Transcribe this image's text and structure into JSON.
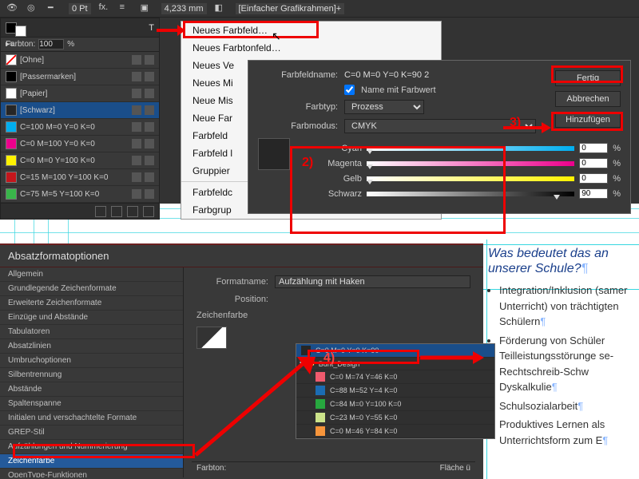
{
  "topbar": {
    "stroke_pt": "0 Pt",
    "dimension": "4,233 mm",
    "frame_type": "[Einfacher Grafikrahmen]+"
  },
  "swatches": {
    "farbton_label": "Farbton:",
    "farbton_value": "100",
    "farbton_pct": "%",
    "rows": [
      {
        "name": "[Ohne]",
        "color": "#ffffff",
        "see_through": true
      },
      {
        "name": "[Passermarken]",
        "color": "#000000",
        "reg": true
      },
      {
        "name": "[Papier]",
        "color": "#ffffff"
      },
      {
        "name": "[Schwarz]",
        "color": "#262626",
        "selected": true
      },
      {
        "name": "C=100 M=0 Y=0 K=0",
        "color": "#00AEEF"
      },
      {
        "name": "C=0 M=100 Y=0 K=0",
        "color": "#EC008C"
      },
      {
        "name": "C=0 M=0 Y=100 K=0",
        "color": "#FFF200"
      },
      {
        "name": "C=15 M=100 Y=100 K=0",
        "color": "#C4161C"
      },
      {
        "name": "C=75 M=5 Y=100 K=0",
        "color": "#39B54A"
      }
    ]
  },
  "context_menu": {
    "items": [
      "Neues Farbfeld…",
      "Neues Farbtonfeld…",
      "Neues Ve",
      "Neues Mi",
      "Neue Mis",
      "Neue Far",
      "Farbfeld ",
      "Farbfeld l",
      "Gruppier",
      "",
      "Farbfeldc",
      "Farbgrup"
    ]
  },
  "dialog": {
    "name_label": "Farbfeldname:",
    "name_value": "C=0 M=0 Y=0 K=90 2",
    "name_with_value_label": "Name mit Farbwert",
    "type_label": "Farbtyp:",
    "type_value": "Prozess",
    "mode_label": "Farbmodus:",
    "mode_value": "CMYK",
    "btn_done": "Fertig",
    "btn_cancel": "Abbrechen",
    "btn_add": "Hinzufügen",
    "sliders": {
      "cyan_label": "Cyan",
      "cyan_value": "0",
      "magenta_label": "Magenta",
      "magenta_value": "0",
      "yellow_label": "Gelb",
      "yellow_value": "0",
      "black_label": "Schwarz",
      "black_value": "90"
    },
    "pct": "%"
  },
  "para_dialog": {
    "title": "Absatzformatoptionen",
    "list": [
      "Allgemein",
      "Grundlegende Zeichenformate",
      "Erweiterte Zeichenformate",
      "Einzüge und Abstände",
      "Tabulatoren",
      "Absatzlinien",
      "Umbruchoptionen",
      "Silbentrennung",
      "Abstände",
      "Spaltenspanne",
      "Initialen und verschachtelte Formate",
      "GREP-Stil",
      "Aufzählungen und Nummerierung",
      "Zeichenfarbe",
      "OpenType-Funktionen"
    ],
    "selected_index": 13,
    "name_label": "Formatname:",
    "name_value": "Aufzählung mit Haken",
    "position_label": "Position:",
    "section_label": "Zeichenfarbe",
    "farbton_label": "Farbton:",
    "space_label": "Fläche ü",
    "colors": {
      "selected": "C=0 M=0 Y=0 K=90",
      "folder": "Bunt_Design",
      "list": [
        {
          "name": "C=0 M=74 Y=46 K=0",
          "color": "#EF5B6E"
        },
        {
          "name": "C=88 M=52 Y=4 K=0",
          "color": "#1B6CB3"
        },
        {
          "name": "C=84 M=0 Y=100 K=0",
          "color": "#27A83F"
        },
        {
          "name": "C=23 M=0 Y=55 K=0",
          "color": "#CCE38A"
        },
        {
          "name": "C=0 M=46 Y=84 K=0",
          "color": "#F7953B"
        }
      ]
    }
  },
  "doc": {
    "heading": "Was bedeutet das an unserer Schule?",
    "items": [
      "Integration/Inklusion (samer Unterricht) von trächtigten Schülern",
      "Förderung von Schüler Teilleistungsstörunge se-Rechtschreib-Schw Dyskalkulie",
      "Schulsozialarbeit",
      "Produktives Lernen als Unterrichtsform zum E"
    ]
  },
  "steps": {
    "s2": "2)",
    "s3": "3)",
    "s4": "4)"
  },
  "chart_data": {
    "type": "table",
    "cmyk_sliders": {
      "Cyan": 0,
      "Magenta": 0,
      "Gelb": 0,
      "Schwarz": 90
    },
    "cmyk_range": [
      0,
      100
    ]
  }
}
